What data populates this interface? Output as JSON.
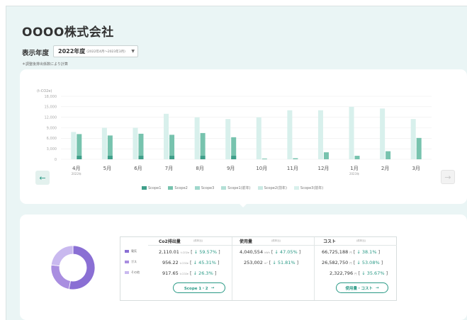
{
  "company_name": "OOOO株式会社",
  "year_selector": {
    "label": "表示年度",
    "value": "2022年度",
    "range": "(2022年4月〜2023年3月)",
    "note": "＊調整後排出係数により計算"
  },
  "colors": {
    "scope1": "#3f9f8a",
    "scope2": "#77c3ae",
    "scope3": "#9fd7cc",
    "scope1_prev": "#b3e0d6",
    "scope2_prev": "#cbeae4",
    "scope3_prev": "#d8f0ec",
    "purple_dark": "#8a6fd4",
    "purple_mid": "#a98ee0",
    "purple_light": "#c9b9ef",
    "accent": "#2a9a86"
  },
  "chart": {
    "prev_label": "←",
    "next_label": "→",
    "legend": [
      "Scope1",
      "Scope2",
      "Scope3",
      "Scope1(前年)",
      "Scope2(前年)",
      "Scope3(前年)"
    ]
  },
  "chart_data": {
    "type": "bar",
    "ylabel": "(t-CO2e)",
    "yticks": [
      "18,000",
      "15,000",
      "12,000",
      "9,000",
      "6,000",
      "3,000",
      "0"
    ],
    "ylim": [
      0,
      18000
    ],
    "categories": [
      "4月",
      "5月",
      "6月",
      "7月",
      "8月",
      "9月",
      "10月",
      "11月",
      "12月",
      "1月",
      "2月",
      "3月"
    ],
    "category_sublabels": [
      "2022年",
      "",
      "",
      "",
      "",
      "",
      "",
      "",
      "",
      "2023年",
      "",
      ""
    ],
    "series": [
      {
        "name": "Scope1",
        "values": [
          1000,
          1000,
          1000,
          1000,
          1000,
          1000,
          0,
          0,
          0,
          0,
          0,
          0
        ]
      },
      {
        "name": "Scope3",
        "values": [
          7200,
          6800,
          7300,
          7000,
          7500,
          6300,
          200,
          300,
          2000,
          1000,
          2300,
          6100
        ]
      },
      {
        "name": "前年",
        "values": [
          7800,
          9000,
          9000,
          13000,
          12000,
          11500,
          12000,
          14000,
          14000,
          15000,
          14500,
          11500
        ]
      }
    ],
    "grid": true
  },
  "summary": {
    "donut": [
      {
        "name": "電気",
        "value": 2110.01
      },
      {
        "name": "ガス",
        "value": 956.22
      },
      {
        "name": "その他",
        "value": 917.65
      }
    ],
    "rows": [
      "電気",
      "ガス",
      "その他"
    ],
    "columns": [
      {
        "title": "Co2排出量",
        "sub": "(前年比)"
      },
      {
        "title": "使用量",
        "sub": "(前年比)"
      },
      {
        "title": "コスト",
        "sub": "(前年比)"
      }
    ],
    "co2": [
      {
        "value": "2,110.01",
        "unit": "t-CO2e",
        "pct": "↓ 59.57%"
      },
      {
        "value": "956.22",
        "unit": "t-CO2e",
        "pct": "↓ 45.31%"
      },
      {
        "value": "917.65",
        "unit": "t-CO2e",
        "pct": "↓ 26.3%"
      }
    ],
    "usage": [
      {
        "value": "4,040,554",
        "unit": "kWh",
        "pct": "↓ 47.05%"
      },
      {
        "value": "253,002",
        "unit": "m³",
        "pct": "↓ 51.81%"
      }
    ],
    "cost": [
      {
        "value": "66,725,188",
        "unit": "円",
        "pct": "↓ 38.1%"
      },
      {
        "value": "26,582,750",
        "unit": "円",
        "pct": "↓ 53.08%"
      },
      {
        "value": "2,322,796",
        "unit": "円",
        "pct": "↓ 35.67%"
      }
    ],
    "scope_button": "Scope 1・2",
    "usage_button": "使用量・コスト"
  }
}
